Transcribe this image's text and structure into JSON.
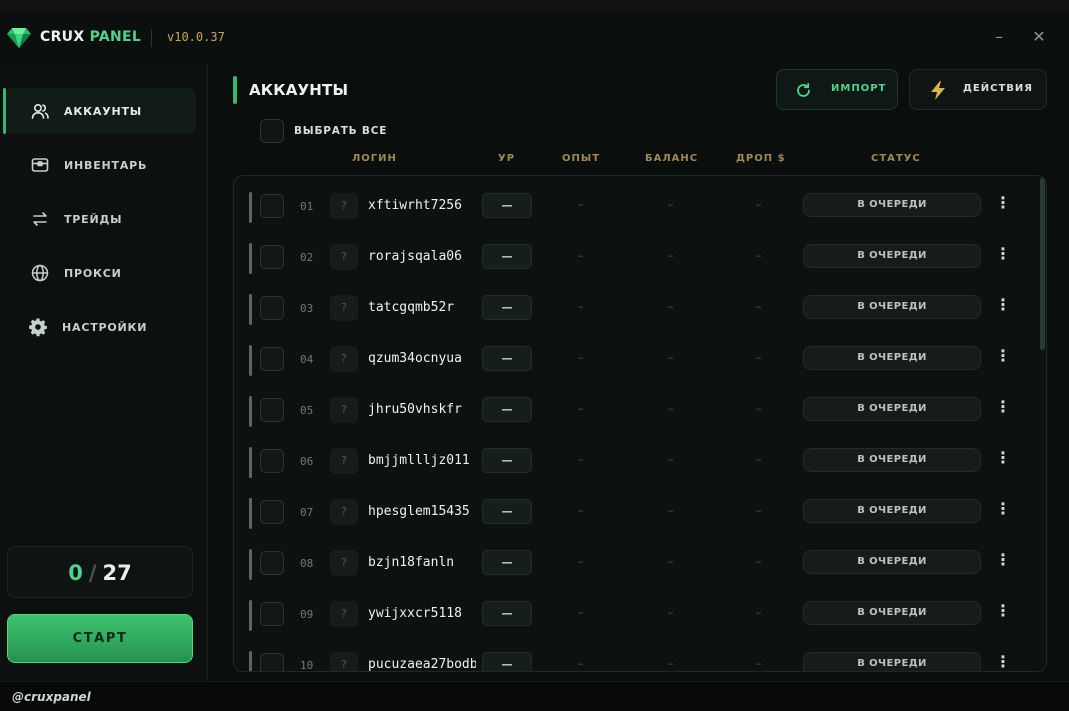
{
  "app": {
    "brand_part1": "CRUX",
    "brand_part2": "PANEL",
    "version": "v10.0.37",
    "minimize_glyph": "–",
    "close_glyph": "✕",
    "brand_color": "#4fd38a"
  },
  "sidebar": {
    "items": [
      {
        "label": "АККАУНТЫ",
        "icon": "users-icon",
        "active": true
      },
      {
        "label": "ИНВЕНТАРЬ",
        "icon": "inventory-icon",
        "active": false
      },
      {
        "label": "ТРЕЙДЫ",
        "icon": "trade-arrows-icon",
        "active": false
      },
      {
        "label": "ПРОКСИ",
        "icon": "globe-icon",
        "active": false
      },
      {
        "label": "НАСТРОЙКИ",
        "icon": "gear-icon",
        "active": false
      }
    ],
    "counter": {
      "done": "0",
      "separator": "/",
      "total": "27"
    },
    "start_label": "СТАРТ"
  },
  "footer": {
    "handle": "@cruxpanel"
  },
  "main": {
    "title": "АККАУНТЫ",
    "import_label": "ИМПОРТ",
    "actions_label": "ДЕЙСТВИЯ",
    "select_all_label": "ВЫБРАТЬ ВСЕ",
    "columns": {
      "login": "ЛОГИН",
      "level": "УР",
      "exp": "ОПЫТ",
      "balance": "БАЛАНС",
      "drop": "ДРОП $",
      "status": "СТАТУС"
    }
  },
  "accounts": [
    {
      "num": "01",
      "q": "?",
      "login": "xftiwrht7256",
      "level": "—",
      "exp": "–",
      "balance": "–",
      "drop": "–",
      "status": "В ОЧЕРЕДИ"
    },
    {
      "num": "02",
      "q": "?",
      "login": "rorajsqala06",
      "level": "—",
      "exp": "–",
      "balance": "–",
      "drop": "–",
      "status": "В ОЧЕРЕДИ"
    },
    {
      "num": "03",
      "q": "?",
      "login": "tatcgqmb52r",
      "level": "—",
      "exp": "–",
      "balance": "–",
      "drop": "–",
      "status": "В ОЧЕРЕДИ"
    },
    {
      "num": "04",
      "q": "?",
      "login": "qzum34ocnyua",
      "level": "—",
      "exp": "–",
      "balance": "–",
      "drop": "–",
      "status": "В ОЧЕРЕДИ"
    },
    {
      "num": "05",
      "q": "?",
      "login": "jhru50vhskfr",
      "level": "—",
      "exp": "–",
      "balance": "–",
      "drop": "–",
      "status": "В ОЧЕРЕДИ"
    },
    {
      "num": "06",
      "q": "?",
      "login": "bmjjmllljz011",
      "level": "—",
      "exp": "–",
      "balance": "–",
      "drop": "–",
      "status": "В ОЧЕРЕДИ"
    },
    {
      "num": "07",
      "q": "?",
      "login": "hpesglem15435",
      "level": "—",
      "exp": "–",
      "balance": "–",
      "drop": "–",
      "status": "В ОЧЕРЕДИ"
    },
    {
      "num": "08",
      "q": "?",
      "login": "bzjn18fanln",
      "level": "—",
      "exp": "–",
      "balance": "–",
      "drop": "–",
      "status": "В ОЧЕРЕДИ"
    },
    {
      "num": "09",
      "q": "?",
      "login": "ywijxxcr5118",
      "level": "—",
      "exp": "–",
      "balance": "–",
      "drop": "–",
      "status": "В ОЧЕРЕДИ"
    },
    {
      "num": "10",
      "q": "?",
      "login": "pucuzaea27bodb",
      "level": "—",
      "exp": "–",
      "balance": "–",
      "drop": "–",
      "status": "В ОЧЕРЕДИ"
    }
  ]
}
